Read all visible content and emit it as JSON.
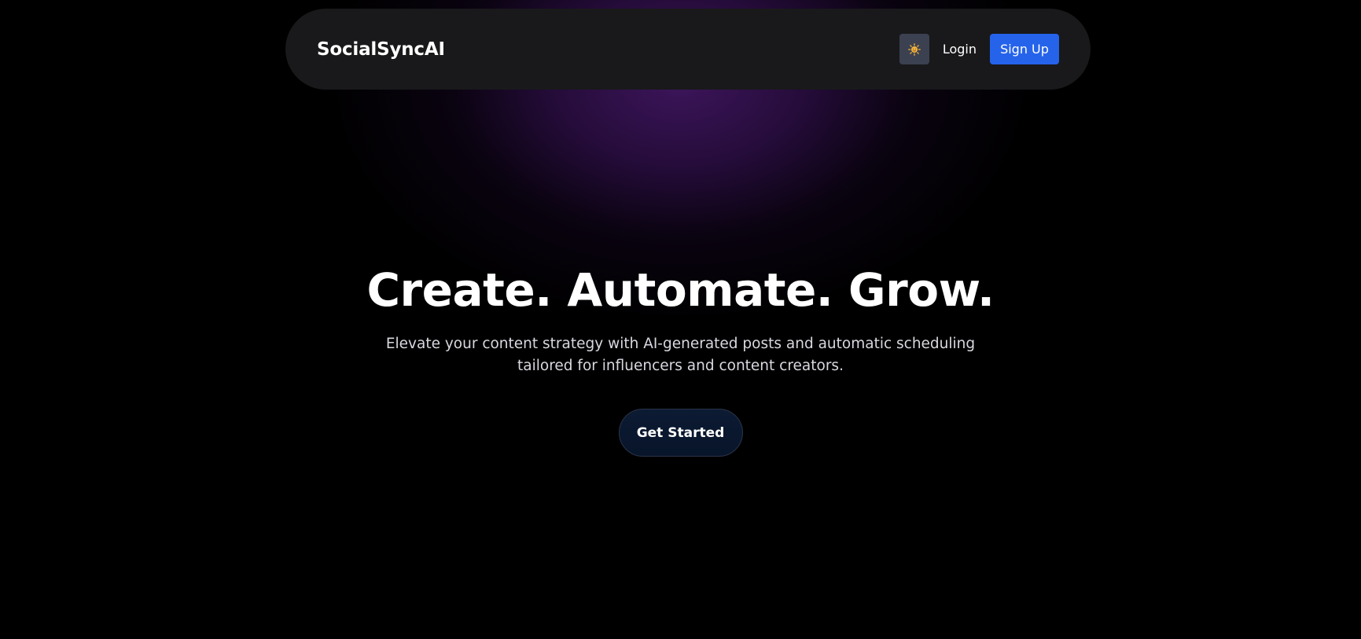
{
  "navbar": {
    "brand": "SocialSyncAI",
    "theme_toggle_icon": "sun-icon",
    "login_label": "Login",
    "signup_label": "Sign Up"
  },
  "hero": {
    "title": "Create. Automate. Grow.",
    "subtitle": "Elevate your content strategy with AI-generated posts and automatic scheduling tailored for influencers and content creators.",
    "cta_label": "Get Started"
  },
  "colors": {
    "background": "#000000",
    "navbar": "#19191b",
    "accent": "#2563eb",
    "glow": "#3a1354",
    "toggle": "#3b4150",
    "cta": "#0b1830"
  }
}
